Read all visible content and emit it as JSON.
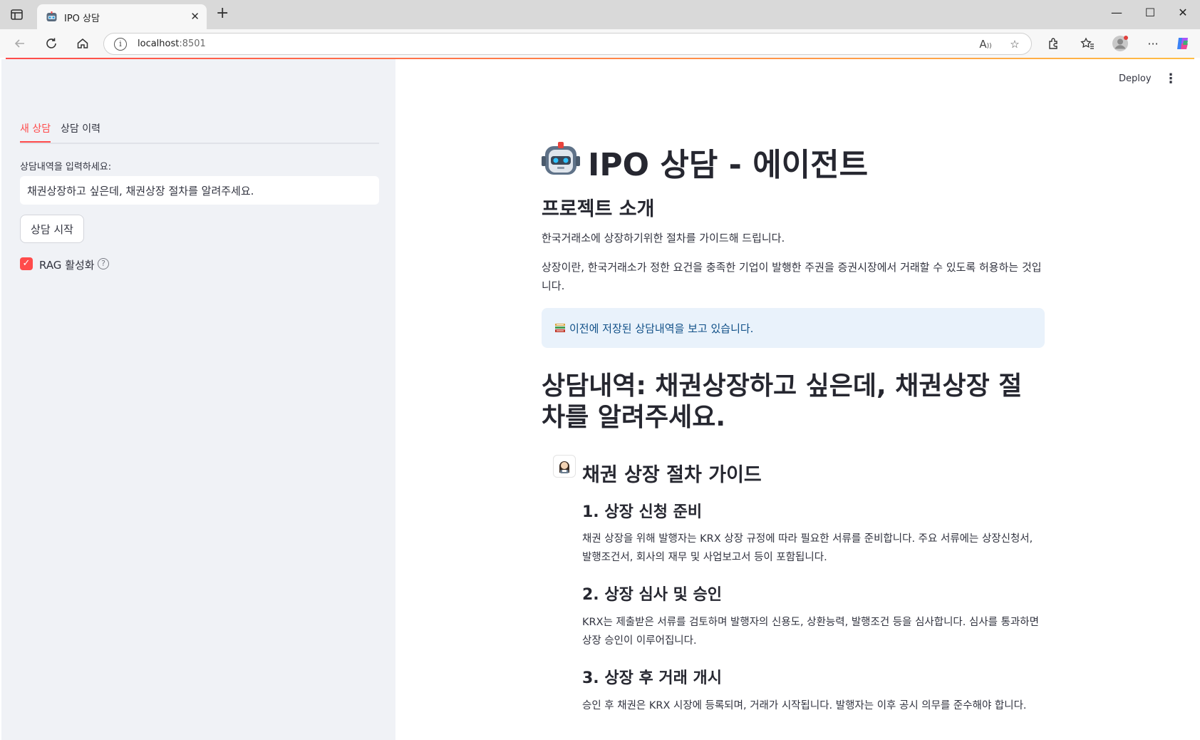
{
  "browser": {
    "tab_title": "IPO 상담",
    "url_host": "localhost",
    "url_port": ":8501"
  },
  "header": {
    "deploy_label": "Deploy"
  },
  "sidebar": {
    "tabs": [
      "새 상담",
      "상담 이력"
    ],
    "input_label": "상담내역을 입력하세요:",
    "input_value": "채권상장하고 싶은데, 채권상장 절차를 알려주세요.",
    "start_button": "상담 시작",
    "rag_label": "RAG 활성화",
    "rag_checked": true
  },
  "main": {
    "title": "IPO 상담 - 에이전트",
    "intro_heading": "프로젝트 소개",
    "intro_p1": "한국거래소에 상장하기위한 절차를 가이드해 드립니다.",
    "intro_p2": "상장이란, 한국거래소가 정한 요건을 충족한 기업이 발행한 주권을 증권시장에서 거래할 수 있도록 허용하는 것입니다.",
    "info_text": "이전에 저장된 상담내역을 보고 있습니다.",
    "consult_heading": "상담내역: 채권상장하고 싶은데, 채권상장 절차를 알려주세요.",
    "guide": {
      "title": "채권 상장 절차 가이드",
      "steps": [
        {
          "heading": "1. 상장 신청 준비",
          "text": "채권 상장을 위해 발행자는 KRX 상장 규정에 따라 필요한 서류를 준비합니다. 주요 서류에는 상장신청서, 발행조건서, 회사의 재무 및 사업보고서 등이 포함됩니다."
        },
        {
          "heading": "2. 상장 심사 및 승인",
          "text": "KRX는 제출받은 서류를 검토하며 발행자의 신용도, 상환능력, 발행조건 등을 심사합니다. 심사를 통과하면 상장 승인이 이루어집니다."
        },
        {
          "heading": "3. 상장 후 거래 개시",
          "text": "승인 후 채권은 KRX 시장에 등록되며, 거래가 시작됩니다. 발행자는 이후 공시 의무를 준수해야 합니다."
        }
      ]
    }
  },
  "colors": {
    "accent": "#ff4b4b",
    "sidebar_bg": "#f0f2f6",
    "info_bg": "#e9f2fb",
    "info_text": "#0f4f87"
  }
}
